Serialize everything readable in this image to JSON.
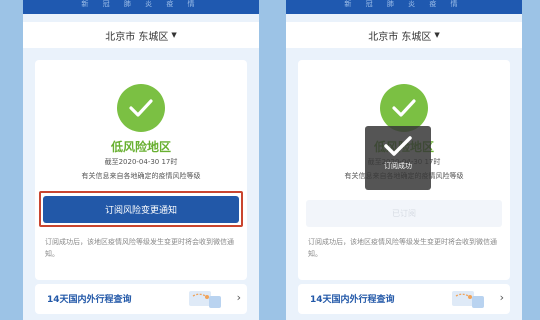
{
  "left": {
    "header_title": "新 冠 肺 炎 疫 情",
    "location": "北京市 东城区",
    "risk_level": "低风险地区",
    "as_of": "截至2020-04-30 17时",
    "source_note": "有关信息来自各地确定的疫情风险等级",
    "subscribe_label": "订阅风险变更通知",
    "notice": "订阅成功后，该地区疫情风险等级发生变更时将会收到微信通知。",
    "itinerary_label": "14天国内外行程查询"
  },
  "right": {
    "header_title": "新 冠 肺 炎 疫 情",
    "location": "北京市 东城区",
    "risk_level": "低风险地区",
    "as_of": "截至2020-04-30 17时",
    "source_note": "有关信息来自各地确定的疫情风险等级",
    "subscribed_label": "已订阅",
    "toast": "订阅成功",
    "notice": "订阅成功后，该地区疫情风险等级发生变更时将会收到微信通知。",
    "itinerary_label": "14天国内外行程查询"
  },
  "icons": {
    "location_caret": "caret-down-icon",
    "status": "check-circle-icon",
    "toast": "check-icon",
    "itinerary_chevron": "chevron-right-icon"
  },
  "colors": {
    "brand_blue": "#2258a8",
    "low_risk_green": "#7bc043",
    "highlight_red": "#c9452f",
    "background": "#9cc3e6"
  }
}
